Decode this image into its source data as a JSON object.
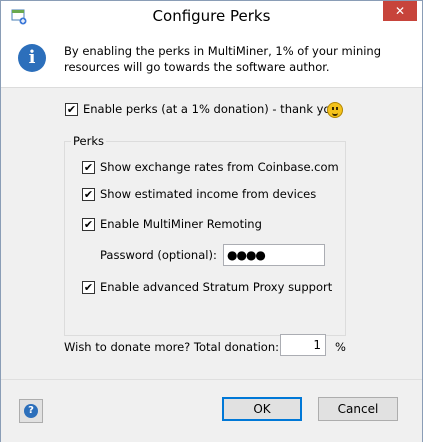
{
  "window": {
    "title": "Configure Perks",
    "close_glyph": "✕",
    "app_icon": "multiminer-app-icon"
  },
  "info": {
    "icon": "info-icon",
    "icon_glyph": "i",
    "message": "By enabling the perks in MultiMiner, 1% of your mining resources will go towards the software author."
  },
  "enable_perks": {
    "label": "Enable perks (at a 1% donation) - thank you!",
    "checked": true,
    "emoji": "smiley-icon"
  },
  "perks": {
    "title": "Perks",
    "items": [
      {
        "label": "Show exchange rates from Coinbase.com",
        "checked": true
      },
      {
        "label": "Show estimated income from devices",
        "checked": true
      },
      {
        "label": "Enable MultiMiner Remoting",
        "checked": true
      },
      {
        "label": "Enable advanced Stratum Proxy support",
        "checked": true
      }
    ],
    "password": {
      "label": "Password (optional):",
      "value": "●●●●"
    }
  },
  "donation": {
    "label": "Wish to donate more? Total donation:",
    "value": "1",
    "unit": "%"
  },
  "buttons": {
    "ok": "OK",
    "cancel": "Cancel",
    "help_glyph": "?"
  },
  "check_glyph": "✔"
}
